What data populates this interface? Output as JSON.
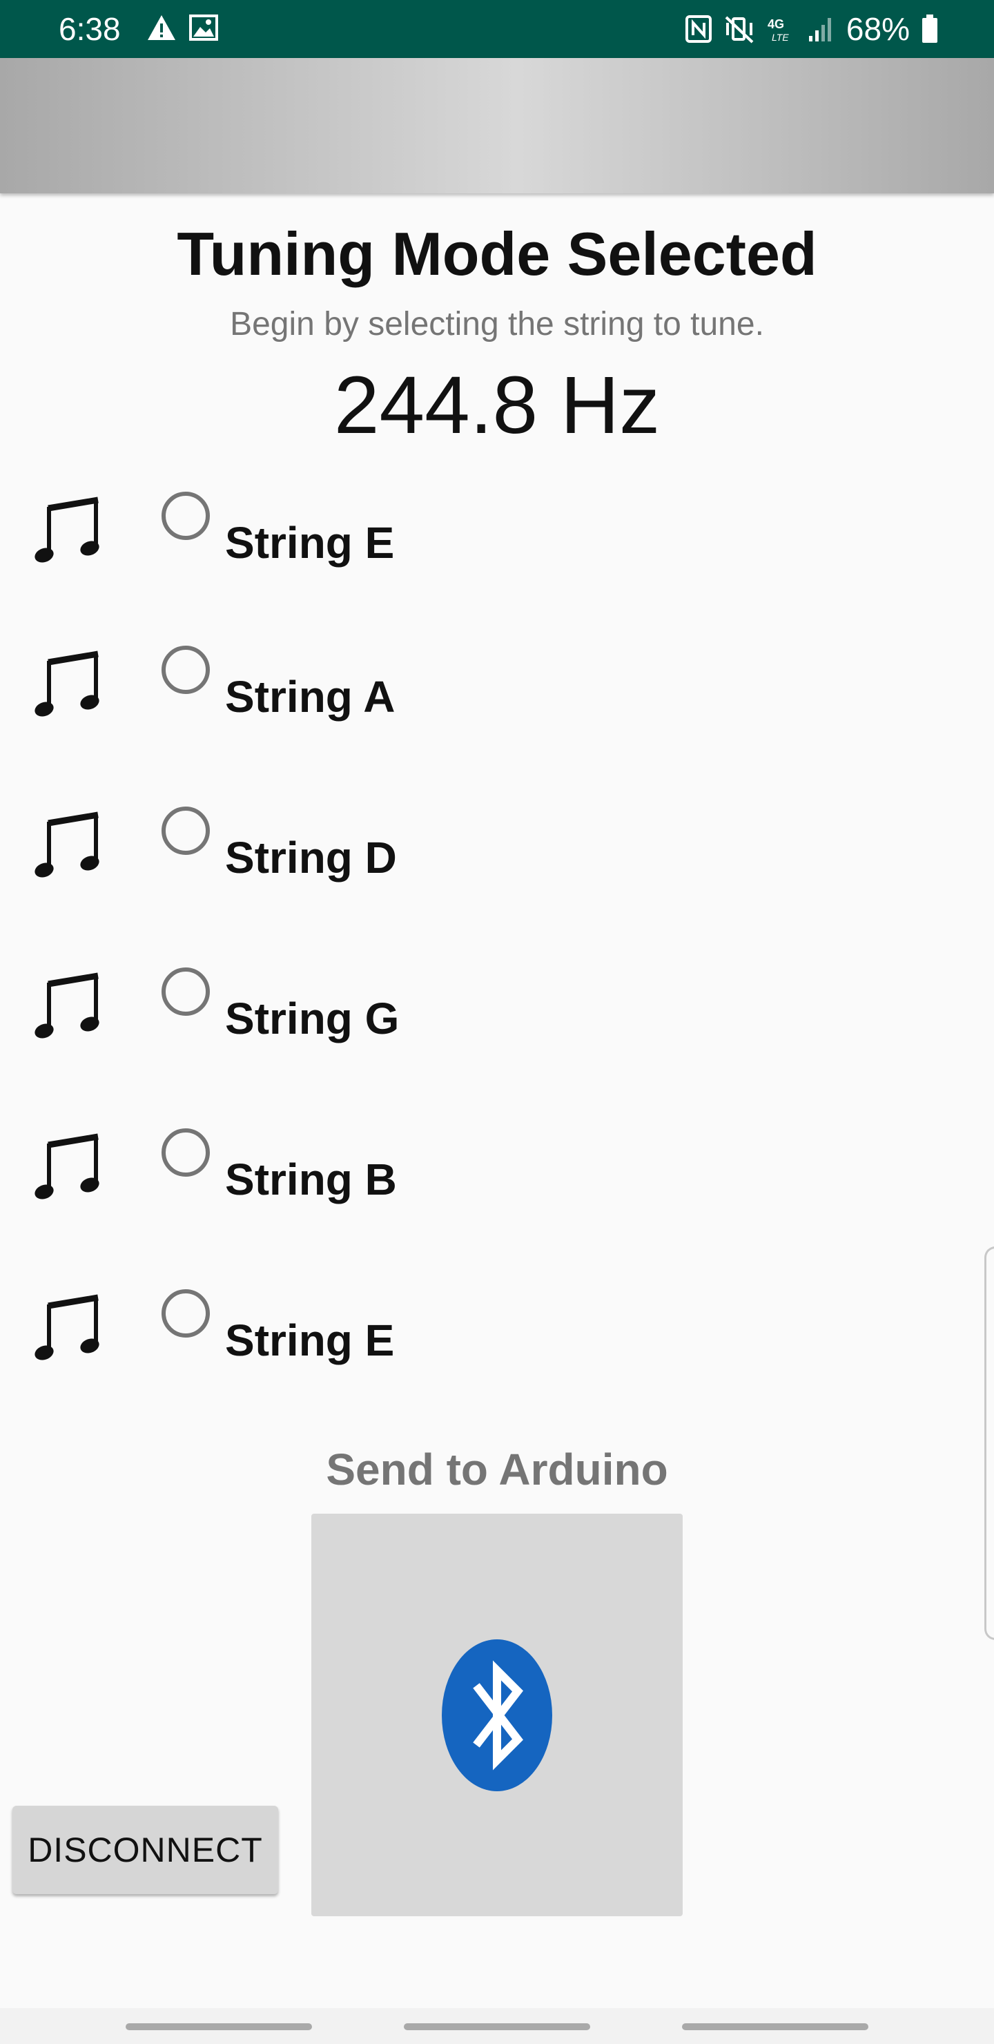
{
  "status_bar": {
    "time": "6:38",
    "left_icons": [
      "warning-icon",
      "image-icon"
    ],
    "right_icons": [
      "nfc-icon",
      "vibrate-mute-icon",
      "lte-icon",
      "signal-icon",
      "battery-icon"
    ],
    "battery_percent": "68%",
    "background_color": "#00574b"
  },
  "main": {
    "title": "Tuning Mode Selected",
    "subtitle": "Begin by selecting the string to tune.",
    "frequency": "244.8 Hz",
    "strings": [
      {
        "label": "String E",
        "selected": false
      },
      {
        "label": "String A",
        "selected": false
      },
      {
        "label": "String D",
        "selected": false
      },
      {
        "label": "String G",
        "selected": false
      },
      {
        "label": "String B",
        "selected": false
      },
      {
        "label": "String E",
        "selected": false
      }
    ],
    "send_label": "Send to Arduino",
    "bluetooth_icon": "bluetooth-icon",
    "bluetooth_color": "#1565c0",
    "disconnect_label": "DISCONNECT"
  }
}
